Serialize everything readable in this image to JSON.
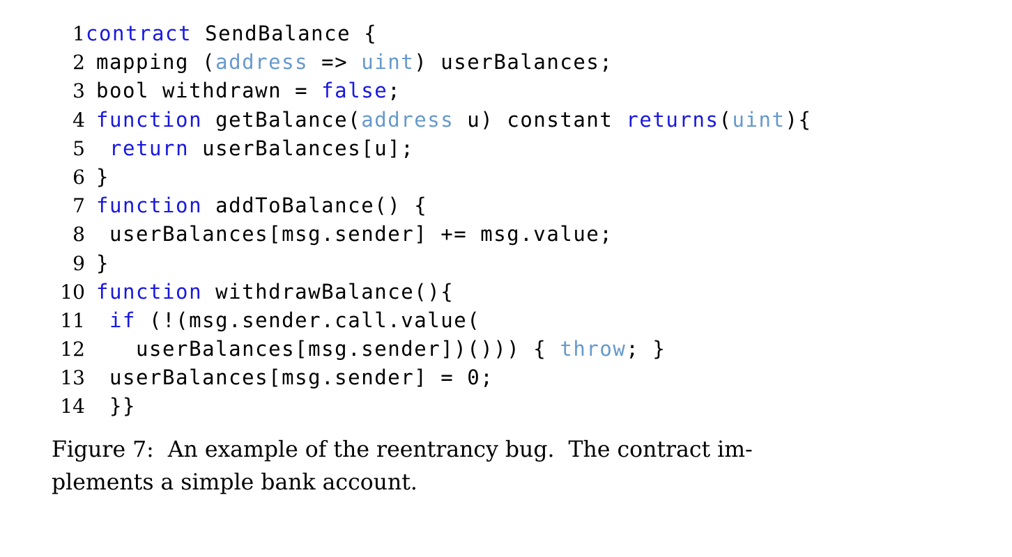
{
  "figure": {
    "language": "Solidity",
    "colors": {
      "background": "#ffffff",
      "text": "#000000",
      "keyword_blue": "#1818e0",
      "type_blue": "#6699cc"
    },
    "code": {
      "lines": [
        {
          "number": "1",
          "tight": true,
          "tokens": [
            {
              "t": "contract",
              "c": "kw"
            },
            {
              "t": " SendBalance {",
              "c": ""
            }
          ]
        },
        {
          "number": "2",
          "tight": false,
          "tokens": [
            {
              "t": "mapping (",
              "c": ""
            },
            {
              "t": "address",
              "c": "typ"
            },
            {
              "t": " => ",
              "c": ""
            },
            {
              "t": "uint",
              "c": "typ"
            },
            {
              "t": ") userBalances;",
              "c": ""
            }
          ]
        },
        {
          "number": "3",
          "tight": false,
          "tokens": [
            {
              "t": "bool withdrawn = ",
              "c": ""
            },
            {
              "t": "false",
              "c": "kw"
            },
            {
              "t": ";",
              "c": ""
            }
          ]
        },
        {
          "number": "4",
          "tight": false,
          "tokens": [
            {
              "t": "function",
              "c": "kw"
            },
            {
              "t": " getBalance(",
              "c": ""
            },
            {
              "t": "address",
              "c": "typ"
            },
            {
              "t": " u) constant ",
              "c": ""
            },
            {
              "t": "returns",
              "c": "kw"
            },
            {
              "t": "(",
              "c": ""
            },
            {
              "t": "uint",
              "c": "typ"
            },
            {
              "t": "){",
              "c": ""
            }
          ]
        },
        {
          "number": "5",
          "tight": false,
          "tokens": [
            {
              "t": " ",
              "c": ""
            },
            {
              "t": "return",
              "c": "kw"
            },
            {
              "t": " userBalances[u];",
              "c": ""
            }
          ]
        },
        {
          "number": "6",
          "tight": false,
          "tokens": [
            {
              "t": "}",
              "c": ""
            }
          ]
        },
        {
          "number": "7",
          "tight": false,
          "tokens": [
            {
              "t": "function",
              "c": "kw"
            },
            {
              "t": " addToBalance() {",
              "c": ""
            }
          ]
        },
        {
          "number": "8",
          "tight": false,
          "tokens": [
            {
              "t": " userBalances[msg.sender] += msg.value;",
              "c": ""
            }
          ]
        },
        {
          "number": "9",
          "tight": false,
          "tokens": [
            {
              "t": "}",
              "c": ""
            }
          ]
        },
        {
          "number": "10",
          "tight": false,
          "tokens": [
            {
              "t": "function",
              "c": "kw"
            },
            {
              "t": " withdrawBalance(){",
              "c": ""
            }
          ]
        },
        {
          "number": "11",
          "tight": false,
          "tokens": [
            {
              "t": " ",
              "c": ""
            },
            {
              "t": "if",
              "c": "kw"
            },
            {
              "t": " (!(msg.sender.call.value(",
              "c": ""
            }
          ]
        },
        {
          "number": "12",
          "tight": false,
          "tokens": [
            {
              "t": "   userBalances[msg.sender])())) { ",
              "c": ""
            },
            {
              "t": "throw",
              "c": "typ"
            },
            {
              "t": "; }",
              "c": ""
            }
          ]
        },
        {
          "number": "13",
          "tight": false,
          "tokens": [
            {
              "t": " userBalances[msg.sender] = 0;",
              "c": ""
            }
          ]
        },
        {
          "number": "14",
          "tight": false,
          "tokens": [
            {
              "t": " }}",
              "c": ""
            }
          ]
        }
      ]
    },
    "caption": {
      "label": "Figure 7:",
      "line1": "Figure 7:  An example of the reentrancy bug.  The contract im-",
      "line2": "plements a simple bank account.",
      "full_text": "Figure 7: An example of the reentrancy bug. The contract implements a simple bank account."
    }
  }
}
